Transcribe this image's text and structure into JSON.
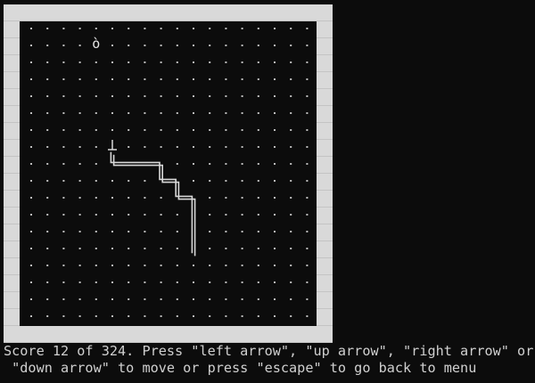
{
  "game": {
    "grid": {
      "columns": 18,
      "rows": 18
    },
    "colors": {
      "wall": "#d3d3d3",
      "playfield": "#0c0c0c",
      "dot": "#bdbdbd",
      "snake": "#d8d8d8",
      "text": "#d0d0d0"
    },
    "food": {
      "glyph": "ò",
      "col": 4,
      "row": 1
    },
    "snake_head": {
      "glyph": "┴",
      "col": 5,
      "row": 7
    },
    "snake_path_cells": [
      [
        5,
        7
      ],
      [
        5,
        8
      ],
      [
        6,
        8
      ],
      [
        7,
        8
      ],
      [
        8,
        8
      ],
      [
        8,
        9
      ],
      [
        9,
        9
      ],
      [
        9,
        10
      ],
      [
        10,
        10
      ],
      [
        10,
        11
      ],
      [
        10,
        12
      ],
      [
        10,
        13
      ]
    ]
  },
  "status": {
    "line1": "Score 12 of 324. Press \"left arrow\", \"up arrow\", \"right arrow\" or",
    "line2": " \"down arrow\" to move or press \"escape\" to go back to menu"
  }
}
